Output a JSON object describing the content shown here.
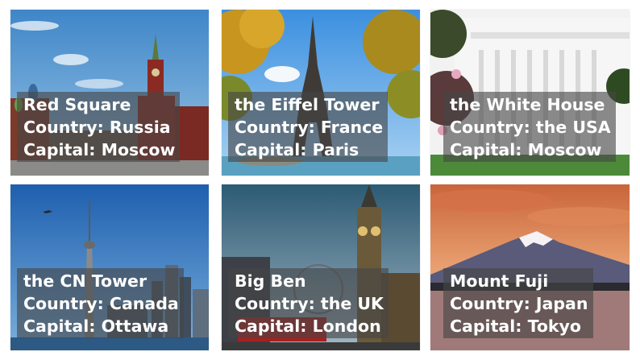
{
  "cards": [
    {
      "title": "Red Square",
      "country": "Country: Russia",
      "capital": "Capital: Moscow"
    },
    {
      "title": "the Eiffel Tower",
      "country": "Country: France",
      "capital": "Capital: Paris"
    },
    {
      "title": "the White House",
      "country": "Country: the USA",
      "capital": "Capital: Moscow"
    },
    {
      "title": "the CN Tower",
      "country": "Country: Canada",
      "capital": "Capital: Ottawa"
    },
    {
      "title": "Big Ben",
      "country": "Country: the UK",
      "capital": "Capital: London"
    },
    {
      "title": "Mount Fuji",
      "country": "Country: Japan",
      "capital": "Capital: Tokyo"
    }
  ],
  "colors": {
    "caption_bg": "#464646",
    "caption_text": "#ffffff"
  }
}
